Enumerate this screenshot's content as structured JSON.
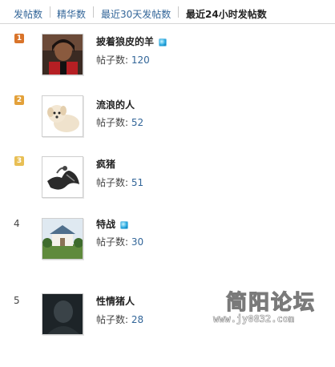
{
  "tabs": [
    {
      "label": "发帖数",
      "active": false
    },
    {
      "label": "精华数",
      "active": false
    },
    {
      "label": "最近30天发帖数",
      "active": false
    },
    {
      "label": "最近24小时发帖数",
      "active": true
    }
  ],
  "posts_label": "帖子数:",
  "users": [
    {
      "rank": "1",
      "name": "披着狼皮的羊",
      "count": "120",
      "online": true,
      "avatar": "person-photo",
      "badge_color": "#d9742a"
    },
    {
      "rank": "2",
      "name": "流浪的人",
      "count": "52",
      "online": false,
      "avatar": "puppy-photo",
      "badge_color": "#e3a13a"
    },
    {
      "rank": "3",
      "name": "疯猪",
      "count": "51",
      "online": false,
      "avatar": "ink-figure",
      "badge_color": "#e8bf55"
    },
    {
      "rank": "4",
      "name": "特战",
      "count": "30",
      "online": true,
      "avatar": "house-photo",
      "badge_color": ""
    },
    {
      "rank": "5",
      "name": "性情猪人",
      "count": "28",
      "online": false,
      "avatar": "dark-portrait",
      "badge_color": ""
    }
  ],
  "watermark": {
    "title": "简阳论坛",
    "url": "www.jy0832.com"
  }
}
